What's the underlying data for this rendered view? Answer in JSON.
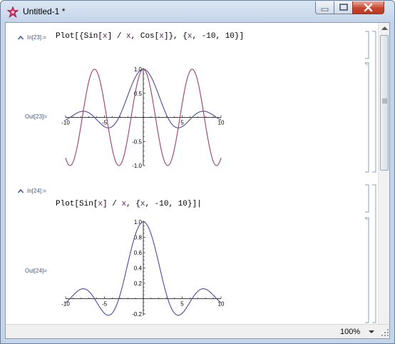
{
  "window": {
    "title": "Untitled-1 *"
  },
  "cells": [
    {
      "in_label": "In[23]:=",
      "input": [
        {
          "t": "Plot[{Sin["
        },
        {
          "t": "x",
          "v": true
        },
        {
          "t": "] / "
        },
        {
          "t": "x",
          "v": true
        },
        {
          "t": ", Cos["
        },
        {
          "t": "x",
          "v": true
        },
        {
          "t": "]}, {"
        },
        {
          "t": "x",
          "v": true
        },
        {
          "t": ", -10, 10}]"
        }
      ],
      "out_label": "Out[23]=",
      "x_ticks": [
        "-10",
        "-5",
        "5",
        "10"
      ],
      "y_ticks": [
        "1.0",
        "0.5",
        "-0.5",
        "-1.0"
      ]
    },
    {
      "in_label": "In[24]:=",
      "input": [
        {
          "t": "Plot[Sin["
        },
        {
          "t": "x",
          "v": true
        },
        {
          "t": "] / "
        },
        {
          "t": "x",
          "v": true
        },
        {
          "t": ", {"
        },
        {
          "t": "x",
          "v": true
        },
        {
          "t": ", -10, 10}]"
        }
      ],
      "out_label": "Out[24]=",
      "x_ticks": [
        "-10",
        "-5",
        "5",
        "10"
      ],
      "y_ticks": [
        "1.0",
        "0.8",
        "0.6",
        "0.4",
        "0.2",
        "-0.2"
      ]
    }
  ],
  "status": {
    "zoom": "100%"
  },
  "colors": {
    "sinc": "#4b4c9a",
    "cos": "#9a3e6e"
  },
  "chart_data": [
    {
      "type": "line",
      "series": [
        {
          "function": "Sin[x]/x",
          "x_range": [
            -10,
            10
          ]
        },
        {
          "function": "Cos[x]",
          "x_range": [
            -10,
            10
          ]
        }
      ],
      "xlim": [
        -10,
        10
      ],
      "ylim": [
        -1,
        1
      ],
      "x_ticks": [
        -10,
        -5,
        5,
        10
      ],
      "y_ticks": [
        1.0,
        0.5,
        -0.5,
        -1.0
      ]
    },
    {
      "type": "line",
      "series": [
        {
          "function": "Sin[x]/x",
          "x_range": [
            -10,
            10
          ]
        }
      ],
      "xlim": [
        -10,
        10
      ],
      "ylim": [
        -0.22,
        1
      ],
      "x_ticks": [
        -10,
        -5,
        5,
        10
      ],
      "y_ticks": [
        1.0,
        0.8,
        0.6,
        0.4,
        0.2,
        -0.2
      ]
    }
  ]
}
